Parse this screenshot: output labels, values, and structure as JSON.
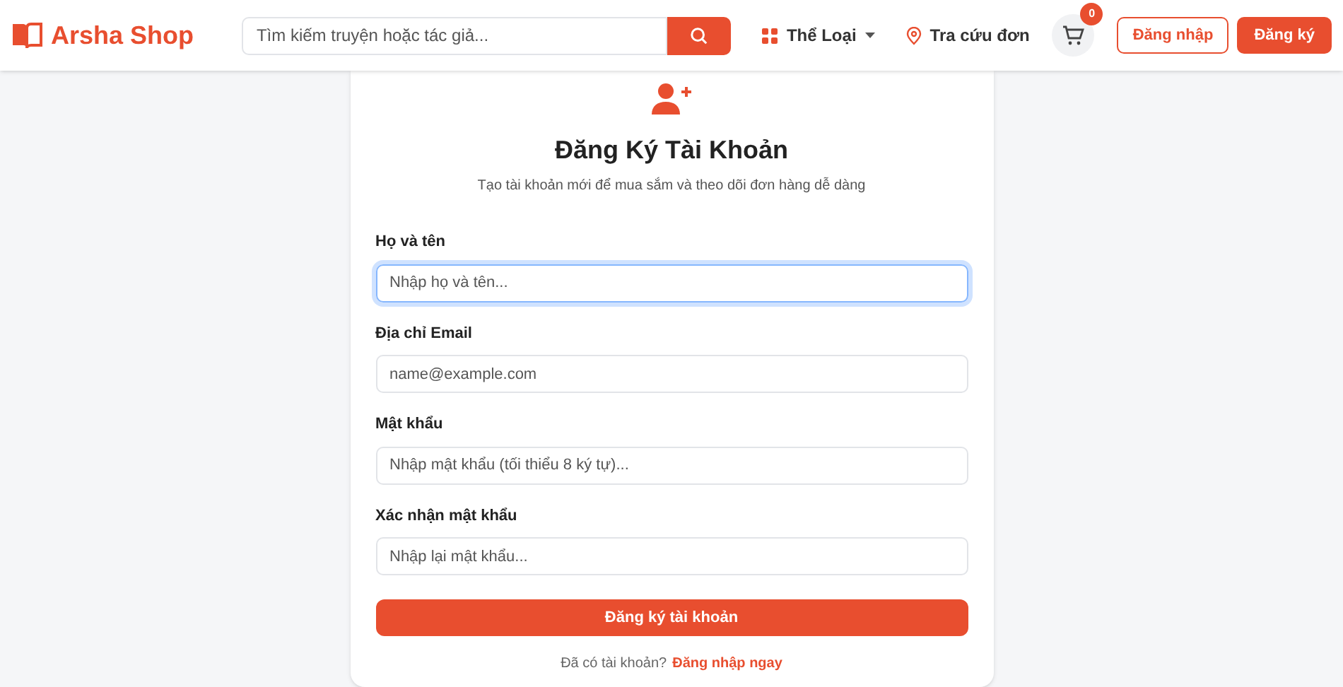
{
  "header": {
    "logo": "Arsha Shop",
    "search": {
      "placeholder": "Tìm kiếm truyện hoặc tác giả..."
    },
    "nav": [
      {
        "kind": "dropdown",
        "label": "Thể Loại"
      },
      {
        "kind": "link",
        "label": "Tra cứu đơn"
      }
    ],
    "cart": {
      "count": "0"
    },
    "buttons": [
      {
        "kind": "outline",
        "label": "Đăng nhập"
      },
      {
        "kind": "filled",
        "label": "Đăng ký"
      }
    ]
  },
  "form": {
    "title": "Đăng Ký Tài Khoản",
    "subtitle": "Tạo tài khoản mới để mua sắm và theo dõi đơn hàng dễ dàng",
    "fields": [
      {
        "label": "Họ và tên",
        "placeholder": "Nhập họ và tên...",
        "focused": true
      },
      {
        "label": "Địa chỉ Email",
        "placeholder": "name@example.com",
        "focused": false
      },
      {
        "label": "Mật khẩu",
        "placeholder": "Nhập mật khẩu (tối thiểu 8 ký tự)...",
        "focused": false
      },
      {
        "label": "Xác nhận mật khẩu",
        "placeholder": "Nhập lại mật khẩu...",
        "focused": false
      }
    ],
    "submit": "Đăng ký tài khoản",
    "footer": {
      "text": "Đã có tài khoản?",
      "link": "Đăng nhập ngay"
    }
  }
}
